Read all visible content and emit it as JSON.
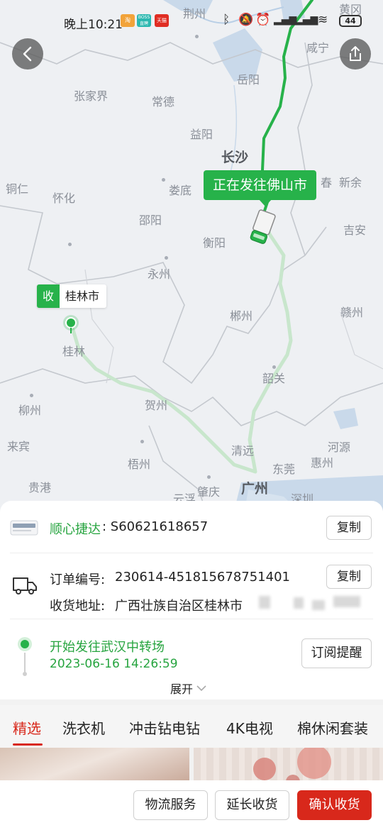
{
  "status_bar": {
    "time": "晚上10:21",
    "app_icons": [
      {
        "name": "taobao-icon",
        "label": "",
        "color": "#f2a33a"
      },
      {
        "name": "boss-zhipin-icon",
        "label": "BOSS直聘",
        "color": "#2bb8b0"
      },
      {
        "name": "tmall-icon",
        "label": "天猫",
        "color": "#e02e24"
      },
      {
        "name": "pinduoduo-icon",
        "label": "",
        "color": "#e02e24"
      }
    ],
    "battery": "44"
  },
  "map": {
    "cities": [
      "荆州",
      "咸宁",
      "黄冈",
      "张家界",
      "常德",
      "岳阳",
      "益阳",
      "长沙",
      "新余",
      "铜仁",
      "怀化",
      "娄底",
      "邵阳",
      "衡阳",
      "吉安",
      "永州",
      "郴州",
      "赣州",
      "桂林",
      "韶关",
      "贺州",
      "柳州",
      "河源",
      "来宾",
      "清远",
      "惠州",
      "梧州",
      "东莞",
      "贵港",
      "广州",
      "肇庆",
      "云浮",
      "深圳",
      "春"
    ],
    "heading_text": "正在发往佛山市",
    "receive_badge": "收",
    "receive_city": "桂林市",
    "route_color_done": "#27b24a",
    "route_color_todo": "#c8e6cc"
  },
  "card": {
    "product_name": "顺心捷达",
    "product_code": ": S60621618657",
    "copy_label": "复制",
    "order_label": "订单编号:",
    "order_number": "230614-451815678751401",
    "address_label": "收货地址:",
    "address_value": "广西壮族自治区桂林市",
    "latest_status": "开始发往武汉中转场",
    "latest_time": "2023-06-16 14:26:59",
    "subscribe_label": "订阅提醒",
    "expand_label": "展开"
  },
  "tabs": [
    "精选",
    "洗衣机",
    "冲击钻电钻",
    "4K电视",
    "棉休闲套装"
  ],
  "bottom_bar": {
    "logistics_label": "物流服务",
    "extend_label": "延长收货",
    "confirm_label": "确认收货"
  },
  "colors": {
    "accent_green": "#27b24a",
    "accent_red": "#d8281b"
  }
}
